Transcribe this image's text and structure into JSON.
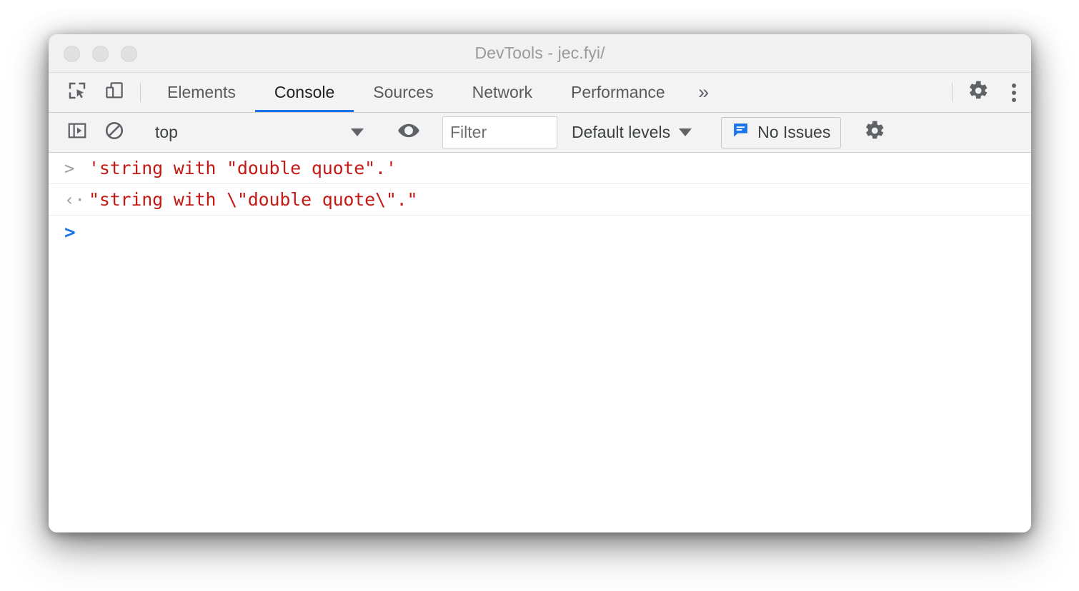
{
  "window": {
    "title": "DevTools - jec.fyi/",
    "traffic_lights": [
      "close",
      "minimize",
      "maximize"
    ]
  },
  "tabbar": {
    "inspect_icon": "inspect-element-icon",
    "device_icon": "device-toolbar-icon",
    "tabs": [
      {
        "label": "Elements",
        "active": false
      },
      {
        "label": "Console",
        "active": true
      },
      {
        "label": "Sources",
        "active": false
      },
      {
        "label": "Network",
        "active": false
      },
      {
        "label": "Performance",
        "active": false
      }
    ],
    "more_tabs": "»",
    "settings_icon": "gear-icon",
    "menu_icon": "more-vertical-icon"
  },
  "console_toolbar": {
    "sidebar_toggle_icon": "console-sidebar-icon",
    "clear_icon": "clear-console-icon",
    "context": "top",
    "eye_icon": "live-expression-eye-icon",
    "filter": {
      "value": "",
      "placeholder": "Filter"
    },
    "levels": {
      "label": "Default levels",
      "caret": "▼"
    },
    "issues": {
      "icon": "issues-message-icon",
      "label": "No Issues",
      "color": "#1a73e8"
    },
    "settings_icon": "console-settings-gear-icon"
  },
  "console": {
    "string_color": "#c41a16",
    "prompt_color": "#1a73e8",
    "rows": [
      {
        "marker": ">",
        "text": "'string with \"double quote\".'",
        "kind": "input"
      },
      {
        "marker": "‹·",
        "text": "\"string with \\\"double quote\\\".\"",
        "kind": "result"
      }
    ],
    "active_prompt": ">"
  }
}
